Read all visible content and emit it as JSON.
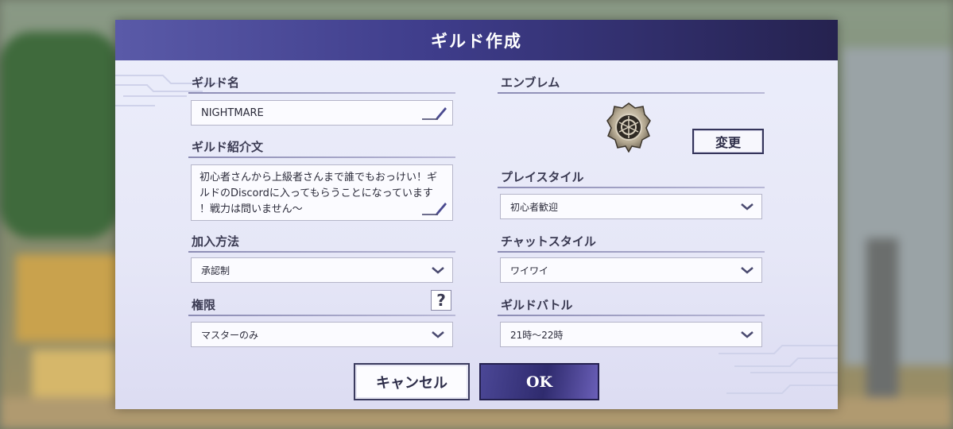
{
  "dialog": {
    "title": "ギルド作成"
  },
  "guild_name": {
    "label": "ギルド名",
    "value": "NIGHTMARE"
  },
  "guild_intro": {
    "label": "ギルド紹介文",
    "lines": [
      "初心者さんから上級者さんまで誰でもおっけい！ギ",
      "ルドのDiscordに入ってもらうことになっています",
      "！戦力は問いません〜"
    ]
  },
  "join_method": {
    "label": "加入方法",
    "value": "承認制"
  },
  "permission": {
    "label": "権限",
    "value": "マスターのみ",
    "help_label": "?"
  },
  "emblem": {
    "label": "エンブレム",
    "change_label": "変更"
  },
  "play_style": {
    "label": "プレイスタイル",
    "value": "初心者歓迎"
  },
  "chat_style": {
    "label": "チャットスタイル",
    "value": "ワイワイ"
  },
  "guild_battle": {
    "label": "ギルドバトル",
    "value": "21時〜22時"
  },
  "buttons": {
    "cancel": "キャンセル",
    "ok": "OK"
  },
  "colors": {
    "title_bar_start": "#5a5aa8",
    "title_bar_end": "#25224f",
    "ok_button": "#2f2b6e"
  },
  "icons": [
    "pen-icon",
    "chevron-down-icon",
    "help-icon",
    "emblem-icon"
  ]
}
